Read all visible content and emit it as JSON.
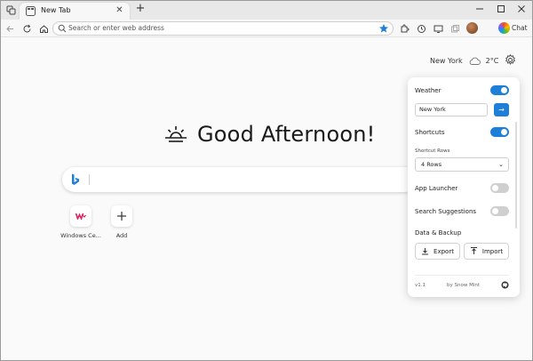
{
  "tab": {
    "title": "New Tab"
  },
  "address_bar": {
    "placeholder": "Search or enter web address"
  },
  "header": {
    "city": "New York",
    "temperature": "2°C"
  },
  "greeting": {
    "text": "Good Afternoon!"
  },
  "shortcuts": [
    {
      "label": "Windows Ce..."
    },
    {
      "label": "Add"
    }
  ],
  "toolbar": {
    "chat_label": "Chat"
  },
  "settings": {
    "weather_label": "Weather",
    "weather_on": true,
    "city_value": "New York",
    "shortcuts_label": "Shortcuts",
    "shortcuts_on": true,
    "shortcut_rows_label": "Shortcut Rows",
    "shortcut_rows_value": "4 Rows",
    "app_launcher_label": "App Launcher",
    "app_launcher_on": false,
    "search_suggestions_label": "Search Suggestions",
    "search_suggestions_on": false,
    "data_backup_label": "Data & Backup",
    "export_label": "Export",
    "import_label": "Import",
    "version": "v1.1",
    "author": "by Snow Mint"
  },
  "colors": {
    "accent": "#1e7fd8"
  }
}
